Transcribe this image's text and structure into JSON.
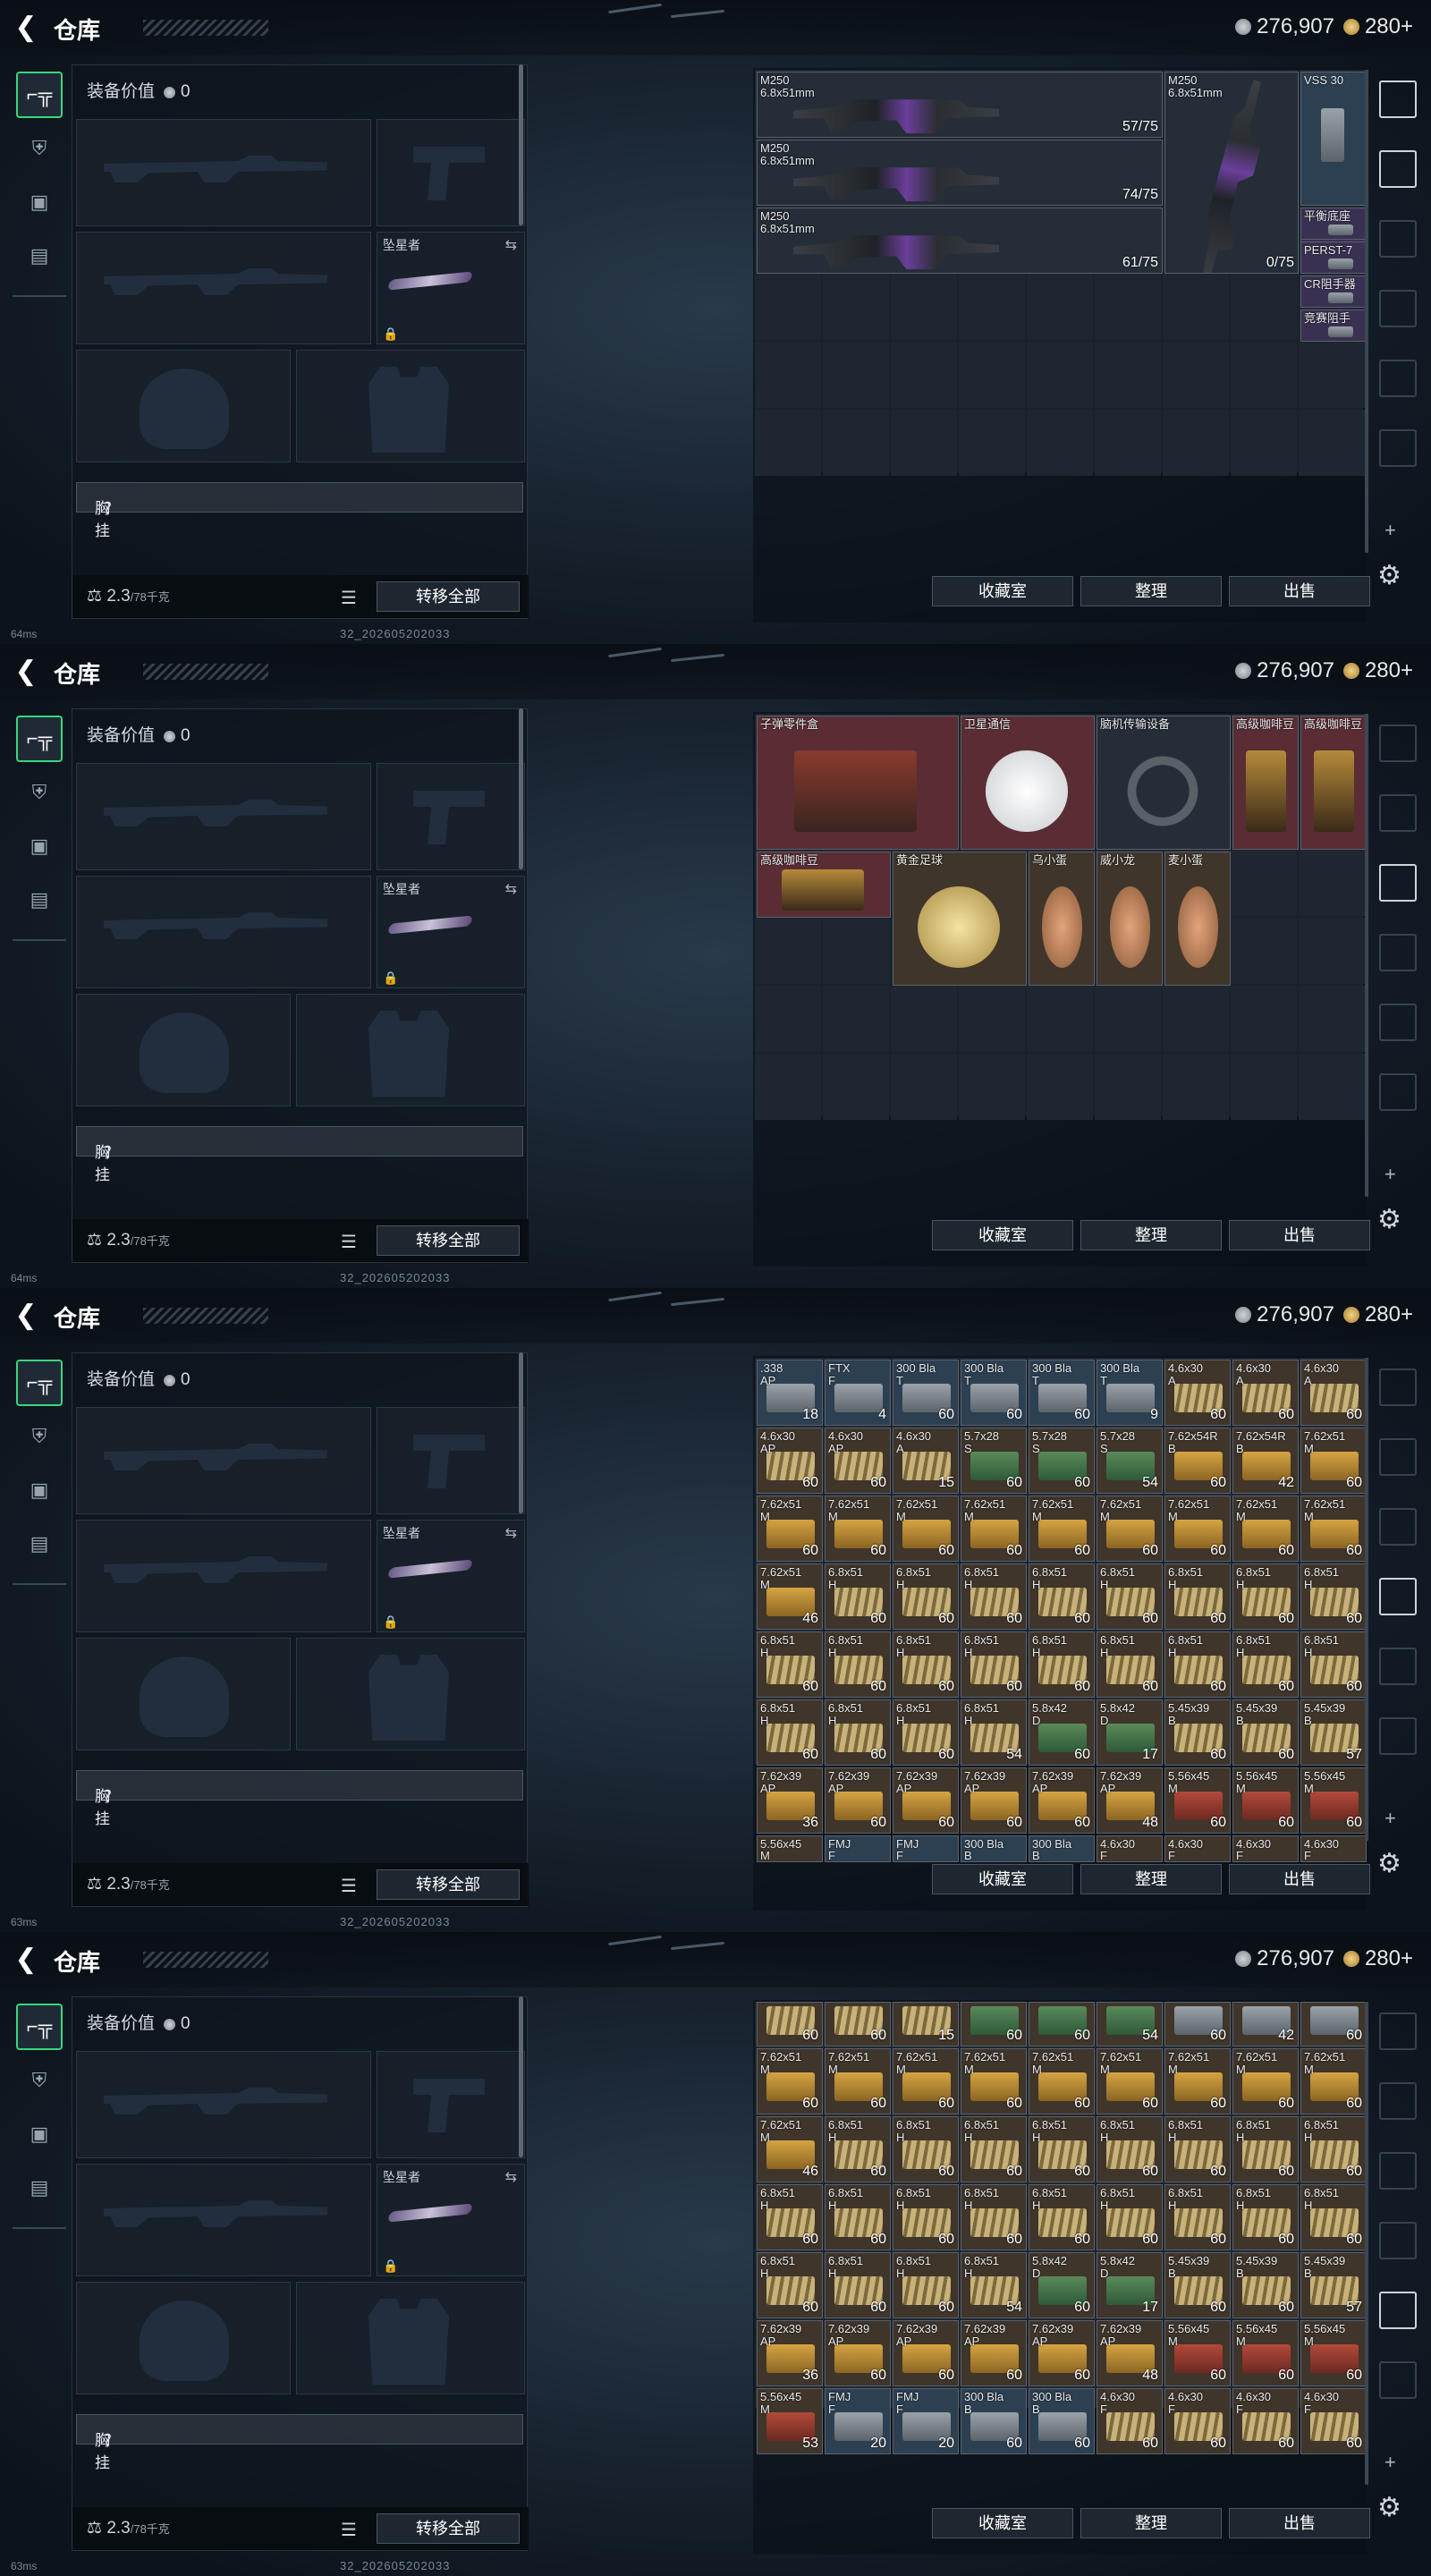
{
  "header": {
    "title": "仓库",
    "silver": "276,907",
    "gold": "280+"
  },
  "status": {
    "ping1": "64ms",
    "ping2": "64ms",
    "ping3": "63ms",
    "ping4": "63ms",
    "build": "32_202605202033"
  },
  "equipment": {
    "value_label": "装备价值",
    "value": "0",
    "melee_label": "坠星者",
    "chest_label": "胸挂",
    "chest_q": "？",
    "weight": "2.3",
    "weight_max": "/78千克",
    "transfer_label": "转移全部"
  },
  "storage_buttons": {
    "collect": "收藏室",
    "sort": "整理",
    "sell": "出售"
  },
  "frame1": {
    "items": [
      {
        "name": "M250",
        "sub": "6.8x51mm",
        "count": "57/75"
      },
      {
        "name": "M250",
        "sub": "6.8x51mm",
        "count": "74/75"
      },
      {
        "name": "M250",
        "sub": "6.8x51mm",
        "count": "61/75"
      },
      {
        "name": "M250",
        "sub": "6.8x51mm",
        "count": "0/75"
      },
      {
        "name": "VSS 30"
      },
      {
        "name": "平衡底座"
      },
      {
        "name": "PERST-7"
      },
      {
        "name": "CR阻手器"
      },
      {
        "name": "竞赛阻手"
      }
    ]
  },
  "frame2": {
    "items": [
      {
        "name": "子弹零件盒"
      },
      {
        "name": "卫星通信"
      },
      {
        "name": "脑机传输设备"
      },
      {
        "name": "高级咖啡豆"
      },
      {
        "name": "高级咖啡豆"
      },
      {
        "name": "高级咖啡豆"
      },
      {
        "name": "黄金足球"
      },
      {
        "name": "乌小蛋"
      },
      {
        "name": "威小龙"
      },
      {
        "name": "麦小蛋"
      }
    ]
  },
  "frame3": {
    "rows": [
      [
        [
          ".338",
          "AP",
          "18"
        ],
        [
          "FTX",
          "F",
          "4"
        ],
        [
          "300 Bla",
          "T",
          "60"
        ],
        [
          "300 Bla",
          "T",
          "60"
        ],
        [
          "300 Bla",
          "T",
          "60"
        ],
        [
          "300 Bla",
          "T",
          "9"
        ],
        [
          "4.6x30",
          "A",
          "60"
        ],
        [
          "4.6x30",
          "A",
          "60"
        ],
        [
          "4.6x30",
          "A",
          "60"
        ]
      ],
      [
        [
          "4.6x30",
          "AP",
          "60"
        ],
        [
          "4.6x30",
          "AP",
          "60"
        ],
        [
          "4.6x30",
          "A",
          "15"
        ],
        [
          "5.7x28",
          "S",
          "60"
        ],
        [
          "5.7x28",
          "S",
          "60"
        ],
        [
          "5.7x28",
          "S",
          "54"
        ],
        [
          "7.62x54R",
          "B",
          "60"
        ],
        [
          "7.62x54R",
          "B",
          "42"
        ],
        [
          "7.62x51",
          "M",
          "60"
        ]
      ],
      [
        [
          "7.62x51",
          "M",
          "60"
        ],
        [
          "7.62x51",
          "M",
          "60"
        ],
        [
          "7.62x51",
          "M",
          "60"
        ],
        [
          "7.62x51",
          "M",
          "60"
        ],
        [
          "7.62x51",
          "M",
          "60"
        ],
        [
          "7.62x51",
          "M",
          "60"
        ],
        [
          "7.62x51",
          "M",
          "60"
        ],
        [
          "7.62x51",
          "M",
          "60"
        ],
        [
          "7.62x51",
          "M",
          "60"
        ]
      ],
      [
        [
          "7.62x51",
          "M",
          "46"
        ],
        [
          "6.8x51",
          "H",
          "60"
        ],
        [
          "6.8x51",
          "H",
          "60"
        ],
        [
          "6.8x51",
          "H",
          "60"
        ],
        [
          "6.8x51",
          "H",
          "60"
        ],
        [
          "6.8x51",
          "H",
          "60"
        ],
        [
          "6.8x51",
          "H",
          "60"
        ],
        [
          "6.8x51",
          "H",
          "60"
        ],
        [
          "6.8x51",
          "H",
          "60"
        ]
      ],
      [
        [
          "6.8x51",
          "H",
          "60"
        ],
        [
          "6.8x51",
          "H",
          "60"
        ],
        [
          "6.8x51",
          "H",
          "60"
        ],
        [
          "6.8x51",
          "H",
          "60"
        ],
        [
          "6.8x51",
          "H",
          "60"
        ],
        [
          "6.8x51",
          "H",
          "60"
        ],
        [
          "6.8x51",
          "H",
          "60"
        ],
        [
          "6.8x51",
          "H",
          "60"
        ],
        [
          "6.8x51",
          "H",
          "60"
        ]
      ],
      [
        [
          "6.8x51",
          "H",
          "60"
        ],
        [
          "6.8x51",
          "H",
          "60"
        ],
        [
          "6.8x51",
          "H",
          "60"
        ],
        [
          "6.8x51",
          "H",
          "54"
        ],
        [
          "5.8x42",
          "D",
          "60"
        ],
        [
          "5.8x42",
          "D",
          "17"
        ],
        [
          "5.45x39",
          "B",
          "60"
        ],
        [
          "5.45x39",
          "B",
          "60"
        ],
        [
          "5.45x39",
          "B",
          "57"
        ]
      ],
      [
        [
          "7.62x39",
          "AP",
          "36"
        ],
        [
          "7.62x39",
          "AP",
          "60"
        ],
        [
          "7.62x39",
          "AP",
          "60"
        ],
        [
          "7.62x39",
          "AP",
          "60"
        ],
        [
          "7.62x39",
          "AP",
          "60"
        ],
        [
          "7.62x39",
          "AP",
          "48"
        ],
        [
          "5.56x45",
          "M",
          "60"
        ],
        [
          "5.56x45",
          "M",
          "60"
        ],
        [
          "5.56x45",
          "M",
          "60"
        ]
      ]
    ],
    "partial": [
      [
        "5.56x45",
        "M"
      ],
      [
        "FMJ",
        "F"
      ],
      [
        "FMJ",
        "F"
      ],
      [
        "300 Bla",
        "B"
      ],
      [
        "300 Bla",
        "B"
      ],
      [
        "4.6x30",
        "F"
      ],
      [
        "4.6x30",
        "F"
      ],
      [
        "4.6x30",
        "F"
      ],
      [
        "4.6x30",
        "F"
      ]
    ]
  },
  "frame4": {
    "toprow": [
      [
        "60"
      ],
      [
        "60"
      ],
      [
        "15"
      ],
      [
        "60"
      ],
      [
        "60"
      ],
      [
        "54"
      ],
      [
        "60"
      ],
      [
        "42"
      ],
      [
        "60"
      ]
    ],
    "rows": [
      [
        [
          "7.62x51",
          "M",
          "60"
        ],
        [
          "7.62x51",
          "M",
          "60"
        ],
        [
          "7.62x51",
          "M",
          "60"
        ],
        [
          "7.62x51",
          "M",
          "60"
        ],
        [
          "7.62x51",
          "M",
          "60"
        ],
        [
          "7.62x51",
          "M",
          "60"
        ],
        [
          "7.62x51",
          "M",
          "60"
        ],
        [
          "7.62x51",
          "M",
          "60"
        ],
        [
          "7.62x51",
          "M",
          "60"
        ]
      ],
      [
        [
          "7.62x51",
          "M",
          "46"
        ],
        [
          "6.8x51",
          "H",
          "60"
        ],
        [
          "6.8x51",
          "H",
          "60"
        ],
        [
          "6.8x51",
          "H",
          "60"
        ],
        [
          "6.8x51",
          "H",
          "60"
        ],
        [
          "6.8x51",
          "H",
          "60"
        ],
        [
          "6.8x51",
          "H",
          "60"
        ],
        [
          "6.8x51",
          "H",
          "60"
        ],
        [
          "6.8x51",
          "H",
          "60"
        ]
      ],
      [
        [
          "6.8x51",
          "H",
          "60"
        ],
        [
          "6.8x51",
          "H",
          "60"
        ],
        [
          "6.8x51",
          "H",
          "60"
        ],
        [
          "6.8x51",
          "H",
          "60"
        ],
        [
          "6.8x51",
          "H",
          "60"
        ],
        [
          "6.8x51",
          "H",
          "60"
        ],
        [
          "6.8x51",
          "H",
          "60"
        ],
        [
          "6.8x51",
          "H",
          "60"
        ],
        [
          "6.8x51",
          "H",
          "60"
        ]
      ],
      [
        [
          "6.8x51",
          "H",
          "60"
        ],
        [
          "6.8x51",
          "H",
          "60"
        ],
        [
          "6.8x51",
          "H",
          "60"
        ],
        [
          "6.8x51",
          "H",
          "54"
        ],
        [
          "5.8x42",
          "D",
          "60"
        ],
        [
          "5.8x42",
          "D",
          "17"
        ],
        [
          "5.45x39",
          "B",
          "60"
        ],
        [
          "5.45x39",
          "B",
          "60"
        ],
        [
          "5.45x39",
          "B",
          "57"
        ]
      ],
      [
        [
          "7.62x39",
          "AP",
          "36"
        ],
        [
          "7.62x39",
          "AP",
          "60"
        ],
        [
          "7.62x39",
          "AP",
          "60"
        ],
        [
          "7.62x39",
          "AP",
          "60"
        ],
        [
          "7.62x39",
          "AP",
          "60"
        ],
        [
          "7.62x39",
          "AP",
          "48"
        ],
        [
          "5.56x45",
          "M",
          "60"
        ],
        [
          "5.56x45",
          "M",
          "60"
        ],
        [
          "5.56x45",
          "M",
          "60"
        ]
      ],
      [
        [
          "5.56x45",
          "M",
          "53"
        ],
        [
          "FMJ",
          "F",
          "20"
        ],
        [
          "FMJ",
          "F",
          "20"
        ],
        [
          "300 Bla",
          "B",
          "60"
        ],
        [
          "300 Bla",
          "B",
          "60"
        ],
        [
          "4.6x30",
          "F",
          "60"
        ],
        [
          "4.6x30",
          "F",
          "60"
        ],
        [
          "4.6x30",
          "F",
          "60"
        ],
        [
          "4.6x30",
          "F",
          "60"
        ]
      ]
    ]
  },
  "colors": {
    "accent": "#3bd67b",
    "panel": "#0e141c"
  }
}
